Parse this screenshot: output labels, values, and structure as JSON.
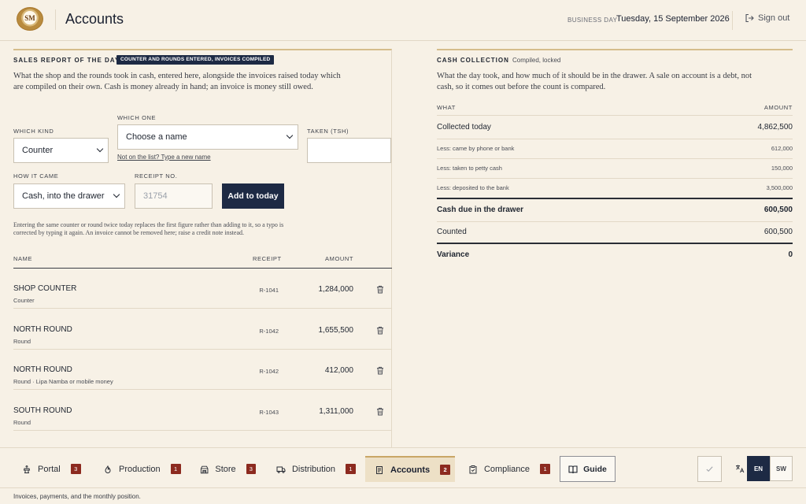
{
  "header": {
    "title": "Accounts",
    "business_day_label": "BUSINESS DAY",
    "business_day_value": "Tuesday, 15 September 2026",
    "sign_out": "Sign out",
    "logo_text": "SM"
  },
  "sales": {
    "title": "SALES REPORT OF THE DAY",
    "status": "COUNTER AND ROUNDS ENTERED, INVOICES COMPILED",
    "description": "What the shop and the rounds took in cash, entered here, alongside the invoices raised today which are compiled on their own. Cash is money already in hand; an invoice is money still owed.",
    "form": {
      "kind_label": "WHICH KIND",
      "kind_value": "Counter",
      "which_label": "WHICH ONE",
      "which_value": "Choose a name",
      "not_listed_link": "Not on the list? Type a new name",
      "taken_label": "TAKEN (TSH)",
      "taken_value": "",
      "how_label": "HOW IT CAME",
      "how_value": "Cash, into the drawer",
      "receipt_label": "RECEIPT NO.",
      "receipt_placeholder": "31754",
      "add_button": "Add to today"
    },
    "note": "Entering the same counter or round twice today replaces the first figure rather than adding to it, so a typo is corrected by typing it again. An invoice cannot be removed here; raise a credit note instead.",
    "columns": {
      "name": "NAME",
      "receipt": "RECEIPT",
      "amount": "AMOUNT"
    },
    "rows": [
      {
        "name": "SHOP COUNTER",
        "sub": "Counter",
        "receipt": "R-1041",
        "amount": "1,284,000"
      },
      {
        "name": "NORTH ROUND",
        "sub": "Round",
        "receipt": "R-1042",
        "amount": "1,655,500"
      },
      {
        "name": "NORTH ROUND",
        "sub": "Round · Lipa Namba or mobile money",
        "receipt": "R-1042",
        "amount": "412,000"
      },
      {
        "name": "SOUTH ROUND",
        "sub": "Round",
        "receipt": "R-1043",
        "amount": "1,311,000"
      }
    ]
  },
  "cash": {
    "title": "CASH COLLECTION",
    "status": "Compiled, locked",
    "description": "What the day took, and how much of it should be in the drawer. A sale on account is a debt, not cash, so it comes out before the count is compared.",
    "columns": {
      "what": "WHAT",
      "amount": "AMOUNT"
    },
    "rows": [
      {
        "what": "Collected today",
        "amount": "4,862,500"
      },
      {
        "what": "Less: came by phone or bank",
        "amount": "612,000"
      },
      {
        "what": "Less: taken to petty cash",
        "amount": "150,000"
      },
      {
        "what": "Less: deposited to the bank",
        "amount": "3,500,000"
      },
      {
        "what": "Cash due in the drawer",
        "amount": "600,500"
      },
      {
        "what": "Counted",
        "amount": "600,500"
      },
      {
        "what": "Variance",
        "amount": "0"
      }
    ]
  },
  "nav": {
    "items": [
      {
        "label": "Portal",
        "badge": "3",
        "icon": "portal-icon"
      },
      {
        "label": "Production",
        "badge": "1",
        "icon": "flame-icon"
      },
      {
        "label": "Store",
        "badge": "3",
        "icon": "store-icon"
      },
      {
        "label": "Distribution",
        "badge": "1",
        "icon": "truck-icon"
      },
      {
        "label": "Accounts",
        "badge": "2",
        "icon": "document-icon"
      },
      {
        "label": "Compliance",
        "badge": "1",
        "icon": "clipboard-icon"
      }
    ],
    "guide": "Guide",
    "lang_en": "EN",
    "lang_sw": "SW",
    "footer": "Invoices, payments, and the monthly position."
  },
  "colors": {
    "navy": "#1d2a44",
    "badge": "#8c2a1f",
    "accent": "#c9a666",
    "background": "#f7f1e6"
  }
}
